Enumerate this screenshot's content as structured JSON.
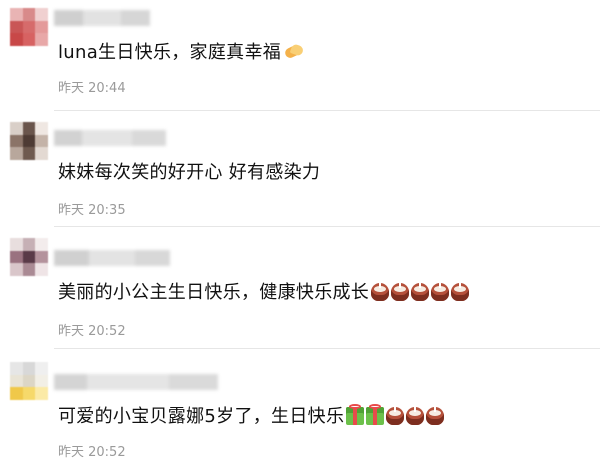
{
  "comments": [
    {
      "text": "luna生日快乐，家庭真幸福",
      "emojis": [
        "clap-icon"
      ],
      "time": "昨天 20:44"
    },
    {
      "text": "妹妹每次笑的好开心 好有感染力",
      "emojis": [],
      "time": "昨天 20:35"
    },
    {
      "text": "美丽的小公主生日快乐，健康快乐成长",
      "emojis": [
        "cake-icon",
        "cake-icon",
        "cake-icon",
        "cake-icon",
        "cake-icon"
      ],
      "time": "昨天 20:52"
    },
    {
      "text": "可爱的小宝贝露娜5岁了，生日快乐",
      "emojis": [
        "gift-icon",
        "gift-icon",
        "cake-icon",
        "cake-icon",
        "cake-icon"
      ],
      "time": "昨天 20:52"
    }
  ],
  "colors": {
    "time_text": "#9a9a9a",
    "divider": "#e6e6e6",
    "cake": "#b5503a",
    "gift": "#6cc04a"
  }
}
